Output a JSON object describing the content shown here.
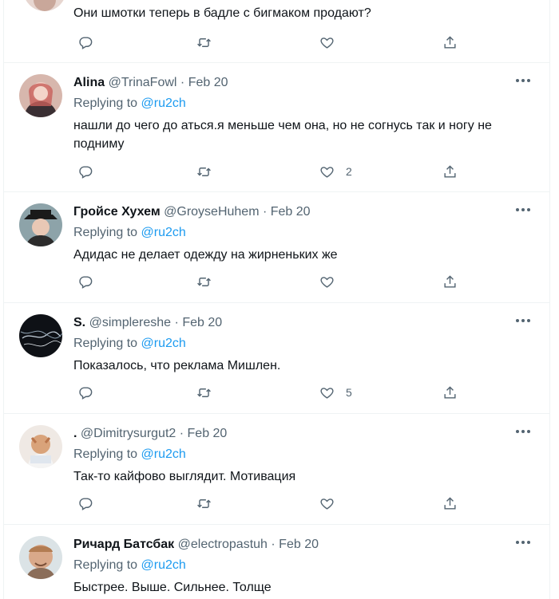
{
  "reply_to_label": "Replying to",
  "tweets": [
    {
      "text": "Они шмотки теперь в бадле с бигмаком продают?",
      "likes": ""
    },
    {
      "name": "Alina",
      "handle": "@TrinaFowl",
      "date": "Feb 20",
      "mention": "@ru2ch",
      "text": "нашли до чего до   аться.я меньше чем она, но не согнусь так и ногу не подниму",
      "likes": "2"
    },
    {
      "name": "Гройсе Хухем",
      "handle": "@GroyseHuhem",
      "date": "Feb 20",
      "mention": "@ru2ch",
      "text": "Адидас не делает одежду на жирненьких же",
      "likes": ""
    },
    {
      "name": "S.",
      "handle": "@simplereshe",
      "date": "Feb 20",
      "mention": "@ru2ch",
      "text": "Показалось, что реклама Мишлен.",
      "likes": "5"
    },
    {
      "name": ".",
      "handle": "@Dimitrysurgut2",
      "date": "Feb 20",
      "mention": "@ru2ch",
      "text": "Так-то кайфово выглядит. Мотивация",
      "likes": ""
    },
    {
      "name": "Ричард Батсбак",
      "handle": "@electropastuh",
      "date": "Feb 20",
      "mention": "@ru2ch",
      "text": "Быстрее. Выше. Сильнее. Толще",
      "likes": ""
    }
  ],
  "icons": [
    "reply-icon",
    "retweet-icon",
    "like-icon",
    "share-icon",
    "more-icon"
  ],
  "colors": {
    "link": "#1d9bf0",
    "secondary": "#536471",
    "text": "#0f1419",
    "divider": "#eff3f4"
  }
}
